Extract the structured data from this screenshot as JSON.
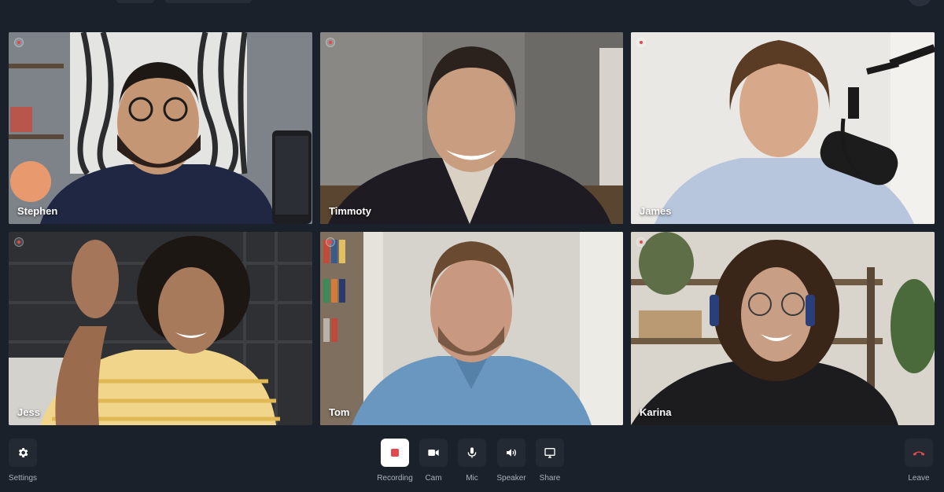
{
  "participants": [
    {
      "name": "Stephen"
    },
    {
      "name": "Timmoty"
    },
    {
      "name": "James"
    },
    {
      "name": "Jess"
    },
    {
      "name": "Tom"
    },
    {
      "name": "Karina"
    }
  ],
  "controls": {
    "settings": "Settings",
    "recording": "Recording",
    "cam": "Cam",
    "mic": "Mic",
    "speaker": "Speaker",
    "share": "Share",
    "leave": "Leave"
  },
  "icons": {
    "settings": "gear-icon",
    "recording": "record-icon",
    "cam": "camera-icon",
    "mic": "microphone-icon",
    "speaker": "speaker-icon",
    "share": "screen-share-icon",
    "leave": "phone-hangup-icon"
  },
  "colors": {
    "background": "#1b212a",
    "button": "#232a34",
    "recording_button": "#ffffff",
    "record_red": "#e5484d",
    "leave_red": "#e5484d"
  }
}
